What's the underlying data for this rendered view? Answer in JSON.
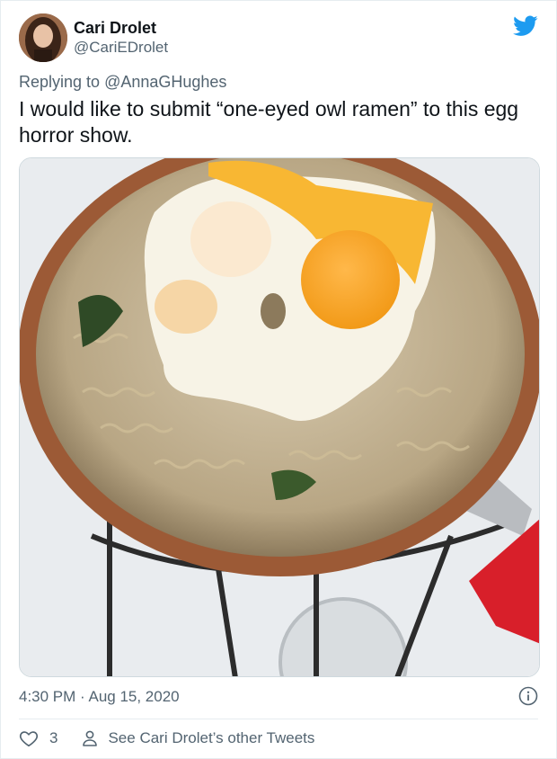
{
  "author": {
    "name": "Cari Drolet",
    "handle": "@CariEDrolet"
  },
  "reply": {
    "prefix": "Replying to",
    "mention": "@AnnaGHughes"
  },
  "tweet_text": "I would like to submit “one-eyed owl ramen” to this egg horror show.",
  "timestamp": "4:30 PM · Aug 15, 2020",
  "actions": {
    "like_count": "3",
    "other_tweets_label": "See Cari Drolet’s other Tweets"
  },
  "colors": {
    "twitter_blue": "#1d9bf0",
    "secondary_text": "#536471",
    "primary_text": "#0f1419"
  }
}
